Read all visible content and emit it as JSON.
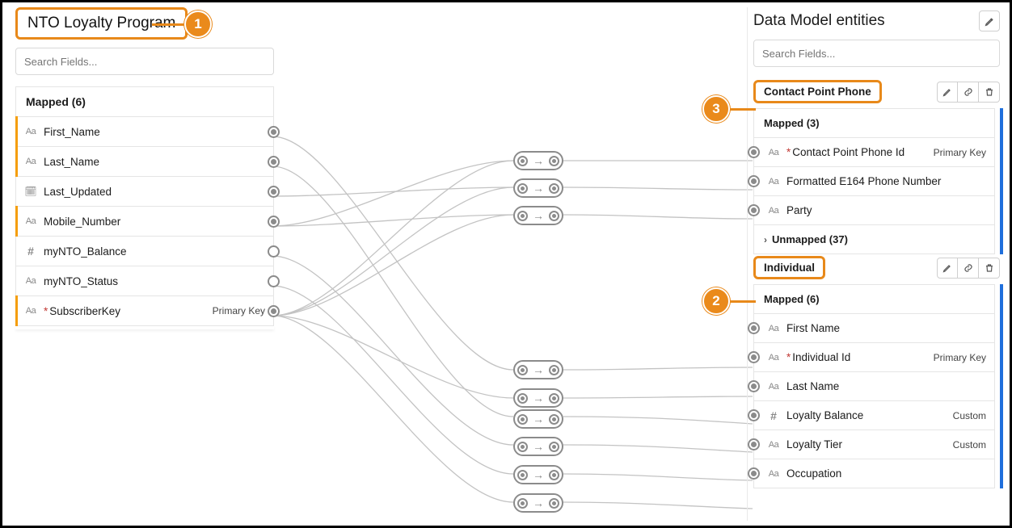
{
  "source": {
    "title": "NTO Loyalty Program",
    "search_placeholder": "Search Fields...",
    "mapped_header": "Mapped (6)",
    "fields": [
      {
        "icon": "text",
        "label": "First_Name",
        "port": "solid",
        "accent": true
      },
      {
        "icon": "text",
        "label": "Last_Name",
        "port": "solid",
        "accent": true
      },
      {
        "icon": "date",
        "label": "Last_Updated",
        "port": "solid",
        "accent": false
      },
      {
        "icon": "text",
        "label": "Mobile_Number",
        "port": "solid",
        "accent": true
      },
      {
        "icon": "hash",
        "label": "myNTO_Balance",
        "port": "hollow",
        "accent": false
      },
      {
        "icon": "text",
        "label": "myNTO_Status",
        "port": "hollow",
        "accent": false
      },
      {
        "icon": "text",
        "label": "SubscriberKey",
        "required": true,
        "pk": "Primary Key",
        "port": "solid",
        "accent": true
      }
    ]
  },
  "target": {
    "title": "Data Model entities",
    "search_placeholder": "Search Fields...",
    "entities": [
      {
        "name": "Contact Point Phone",
        "mapped_header": "Mapped (3)",
        "fields": [
          {
            "icon": "text",
            "label": "Contact Point Phone Id",
            "required": true,
            "pk": "Primary Key"
          },
          {
            "icon": "text",
            "label": "Formatted E164 Phone Number"
          },
          {
            "icon": "text",
            "label": "Party"
          }
        ],
        "unmapped": "Unmapped (37)"
      },
      {
        "name": "Individual",
        "mapped_header": "Mapped (6)",
        "fields": [
          {
            "icon": "text",
            "label": "First Name"
          },
          {
            "icon": "text",
            "label": "Individual Id",
            "required": true,
            "pk": "Primary Key"
          },
          {
            "icon": "text",
            "label": "Last Name"
          },
          {
            "icon": "hash",
            "label": "Loyalty Balance",
            "custom": "Custom"
          },
          {
            "icon": "text",
            "label": "Loyalty Tier",
            "custom": "Custom"
          },
          {
            "icon": "text",
            "label": "Occupation"
          }
        ]
      }
    ]
  },
  "callouts": {
    "c1": "1",
    "c2": "2",
    "c3": "3"
  }
}
